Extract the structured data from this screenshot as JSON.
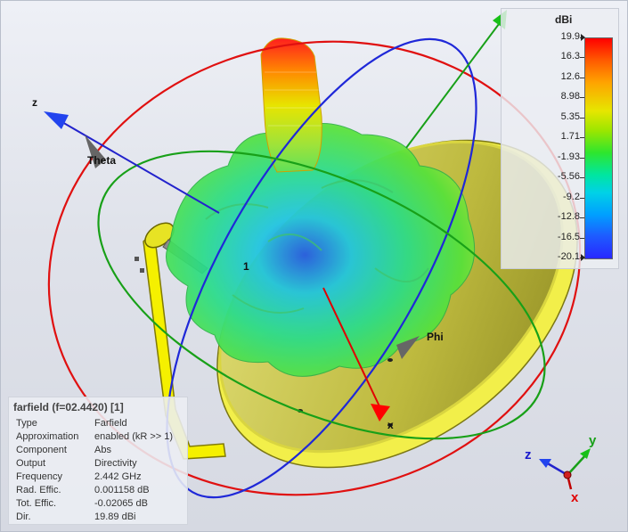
{
  "axes": {
    "z_label": "z",
    "theta_label": "Theta",
    "phi_label": "Phi",
    "x_label": "x",
    "port_label": "1"
  },
  "colorbar": {
    "unit": "dBi",
    "ticks": [
      "19.9",
      "16.3",
      "12.6",
      "8.98",
      "5.35",
      "1.71",
      "-1.93",
      "-5.56",
      "-9.2",
      "-12.8",
      "-16.5",
      "-20.1"
    ]
  },
  "info": {
    "title": "farfield (f=02.4420) [1]",
    "rows": [
      {
        "key": "Type",
        "value": "Farfield"
      },
      {
        "key": "Approximation",
        "value": "enabled (kR >> 1)"
      },
      {
        "key": "Component",
        "value": "Abs"
      },
      {
        "key": "Output",
        "value": "Directivity"
      },
      {
        "key": "Frequency",
        "value": "2.442 GHz"
      },
      {
        "key": "Rad. Effic.",
        "value": "0.001158 dB"
      },
      {
        "key": "Tot. Effic.",
        "value": "-0.02065 dB"
      },
      {
        "key": "Dir.",
        "value": "19.89 dBi"
      }
    ]
  },
  "triad": {
    "x": "x",
    "y": "y",
    "z": "z"
  },
  "colors": {
    "x_axis": "#e00000",
    "y_axis": "#1a9a1a",
    "z_axis": "#1a1acc"
  }
}
